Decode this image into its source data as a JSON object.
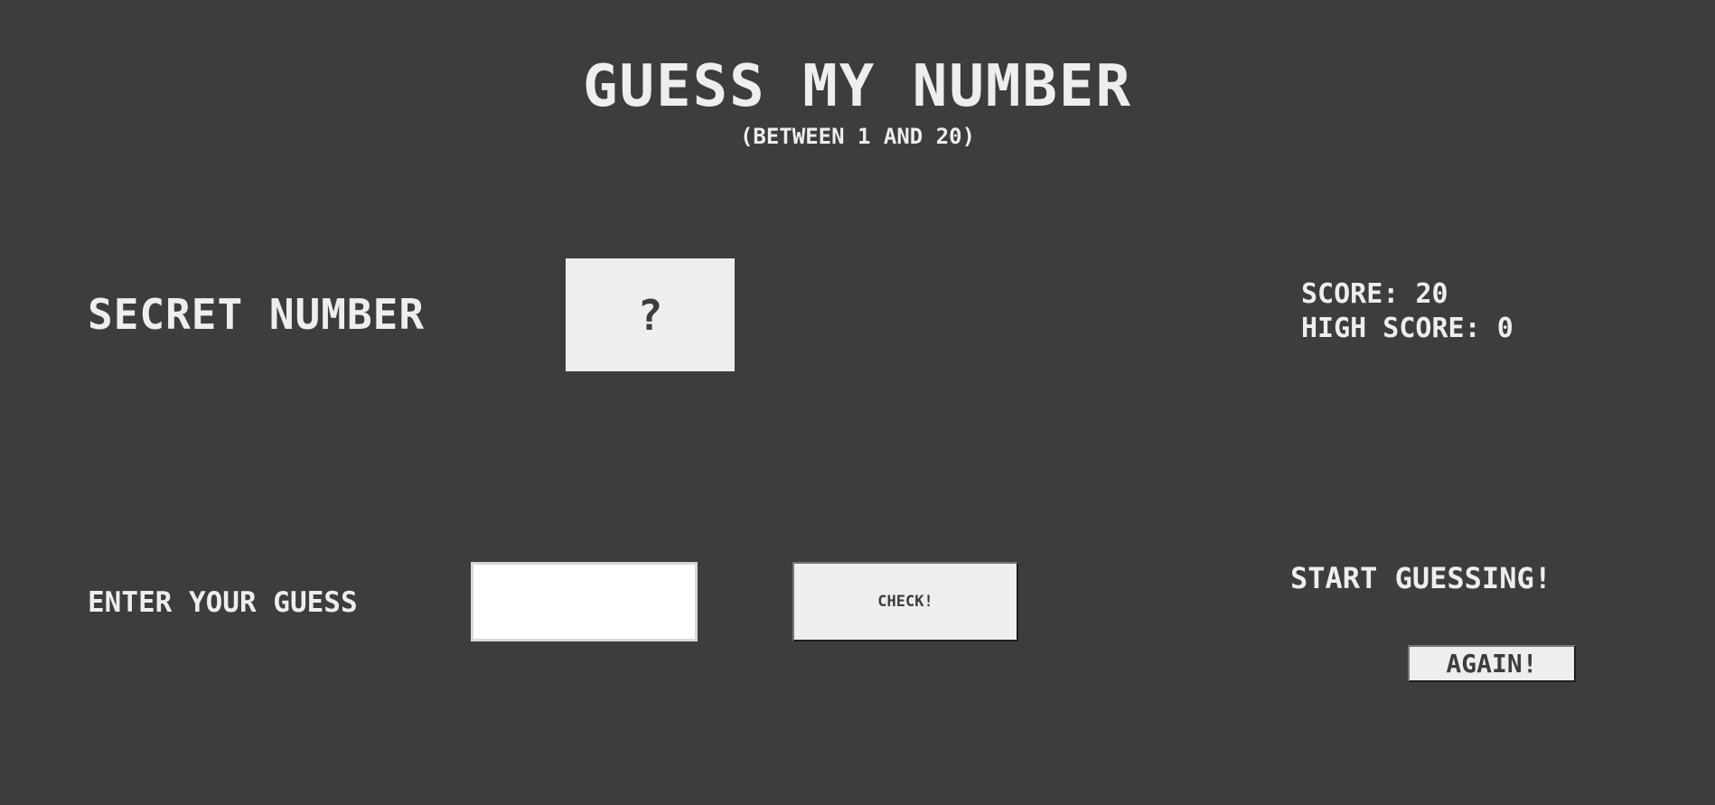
{
  "header": {
    "title": "GUESS MY NUMBER",
    "subtitle": "(BETWEEN 1 AND 20)"
  },
  "secret": {
    "label": "SECRET NUMBER",
    "value": "?"
  },
  "scoreboard": {
    "score_label": "SCORE:",
    "score": "20",
    "highscore_label": "HIGH SCORE:",
    "highscore": "0"
  },
  "guess": {
    "label": "ENTER YOUR GUESS",
    "value": "",
    "check_label": "CHECK!"
  },
  "status": {
    "message": "START GUESSING!",
    "again_label": "AGAIN!"
  },
  "colors": {
    "background": "#3d3d3d",
    "foreground": "#eeeeee",
    "input_background": "#ffffff"
  }
}
